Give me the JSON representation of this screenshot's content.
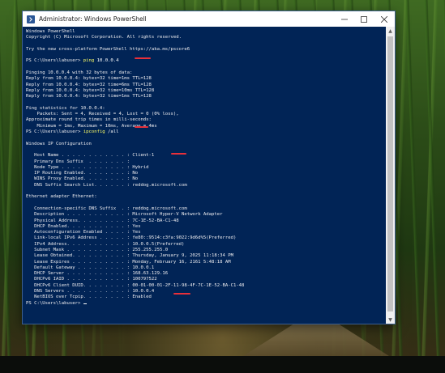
{
  "window": {
    "title": "Administrator: Windows PowerShell",
    "minimize_icon": "minimize-icon",
    "maximize_icon": "maximize-icon",
    "close_icon": "close-icon"
  },
  "colors": {
    "console_bg": "#012456",
    "console_text": "#eeedf0",
    "command_text": "#ffff66",
    "annotation": "#e8303a"
  },
  "console": {
    "lines": [
      {
        "text": "Windows PowerShell"
      },
      {
        "text": "Copyright (C) Microsoft Corporation. All rights reserved."
      },
      {
        "text": ""
      },
      {
        "text": "Try the new cross-platform PowerShell https://aka.ms/pscore6"
      },
      {
        "text": ""
      },
      {
        "prompt": "PS C:\\Users\\labuser> ",
        "cmd": "ping",
        "arg": " 10.0.0.4"
      },
      {
        "text": ""
      },
      {
        "text": "Pinging 10.0.0.4 with 32 bytes of data:"
      },
      {
        "text": "Reply from 10.0.0.4: bytes=32 time=1ms TTL=128"
      },
      {
        "text": "Reply from 10.0.0.4: bytes=32 time=6ms TTL=128"
      },
      {
        "text": "Reply from 10.0.0.4: bytes=32 time=10ms TTL=128"
      },
      {
        "text": "Reply from 10.0.0.4: bytes=32 time=1ms TTL=128"
      },
      {
        "text": ""
      },
      {
        "text": "Ping statistics for 10.0.0.4:"
      },
      {
        "text": "    Packets: Sent = 4, Received = 4, Lost = 0 (0% loss),"
      },
      {
        "text": "Approximate round trip times in milli-seconds:"
      },
      {
        "text": "    Minimum = 1ms, Maximum = 10ms, Average = 4ms"
      },
      {
        "prompt": "PS C:\\Users\\labuser> ",
        "cmd": "ipconfig",
        "arg": " /all"
      },
      {
        "text": ""
      },
      {
        "text": "Windows IP Configuration"
      },
      {
        "text": ""
      },
      {
        "text": "   Host Name . . . . . . . . . . . . : Client-1"
      },
      {
        "text": "   Primary Dns Suffix  . . . . . . . :"
      },
      {
        "text": "   Node Type . . . . . . . . . . . . : Hybrid"
      },
      {
        "text": "   IP Routing Enabled. . . . . . . . : No"
      },
      {
        "text": "   WINS Proxy Enabled. . . . . . . . : No"
      },
      {
        "text": "   DNS Suffix Search List. . . . . . : reddog.microsoft.com"
      },
      {
        "text": ""
      },
      {
        "text": "Ethernet adapter Ethernet:"
      },
      {
        "text": ""
      },
      {
        "text": "   Connection-specific DNS Suffix  . : reddog.microsoft.com"
      },
      {
        "text": "   Description . . . . . . . . . . . : Microsoft Hyper-V Network Adapter"
      },
      {
        "text": "   Physical Address. . . . . . . . . : 7C-1E-52-BA-C1-48"
      },
      {
        "text": "   DHCP Enabled. . . . . . . . . . . : Yes"
      },
      {
        "text": "   Autoconfiguration Enabled . . . . : Yes"
      },
      {
        "text": "   Link-local IPv6 Address . . . . . : fe80::9514:c3fa:9022:9d6d%5(Preferred)"
      },
      {
        "text": "   IPv4 Address. . . . . . . . . . . : 10.0.0.5(Preferred)"
      },
      {
        "text": "   Subnet Mask . . . . . . . . . . . : 255.255.255.0"
      },
      {
        "text": "   Lease Obtained. . . . . . . . . . : Thursday, January 9, 2025 11:18:34 PM"
      },
      {
        "text": "   Lease Expires . . . . . . . . . . : Monday, February 16, 2161 5:48:18 AM"
      },
      {
        "text": "   Default Gateway . . . . . . . . . : 10.0.0.1"
      },
      {
        "text": "   DHCP Server . . . . . . . . . . . : 168.63.129.16"
      },
      {
        "text": "   DHCPv6 IAID . . . . . . . . . . . : 100797522"
      },
      {
        "text": "   DHCPv6 Client DUID. . . . . . . . : 00-01-00-01-2F-11-98-4F-7C-1E-52-BA-C1-48"
      },
      {
        "text": "   DNS Servers . . . . . . . . . . . : 10.0.0.4"
      },
      {
        "text": "   NetBIOS over Tcpip. . . . . . . . : Enabled"
      },
      {
        "prompt": "PS C:\\Users\\labuser> ",
        "cmd": "",
        "arg": ""
      }
    ]
  }
}
